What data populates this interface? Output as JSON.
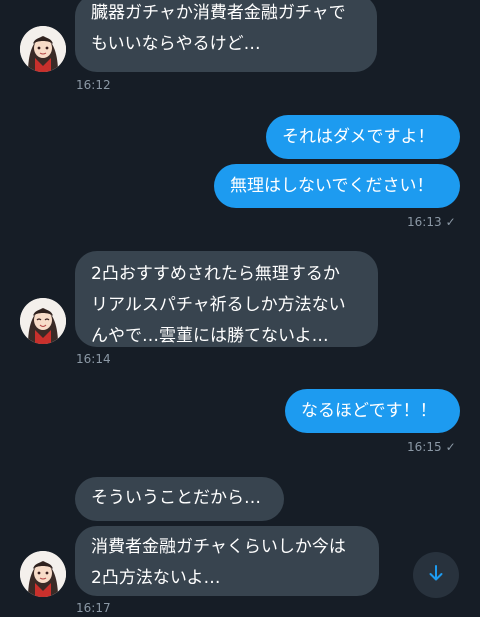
{
  "messages": [
    {
      "dir": "in",
      "text": "臓器ガチャか消費者金融ガチャで\nもいいならやるけど…"
    },
    {
      "dir": "out",
      "text": "それはダメですよ！"
    },
    {
      "dir": "out",
      "text": "無理はしないでください！"
    },
    {
      "dir": "in",
      "text": "2凸おすすめされたら無理するか\nリアルスパチャ祈るしか方法ない\nんやで…雲菫には勝てないよ…"
    },
    {
      "dir": "out",
      "text": "なるほどです！！"
    },
    {
      "dir": "in",
      "text": "そういうことだから…"
    },
    {
      "dir": "in",
      "text": "消費者金融ガチャくらいしか今は\n2凸方法ないよ…"
    }
  ],
  "timestamps": {
    "t1": "16:12",
    "t2": "16:13",
    "t3": "16:14",
    "t4": "16:15",
    "t5": "16:17"
  },
  "read_check": "✓",
  "icons": {
    "avatar": "avatar-icon",
    "scroll_down": "arrow-down-icon"
  },
  "colors": {
    "background": "#161d26",
    "incoming_bubble": "#38444f",
    "outgoing_bubble": "#1d9bf0",
    "timestamp": "#8b98a5",
    "accent": "#1d9bf0"
  }
}
